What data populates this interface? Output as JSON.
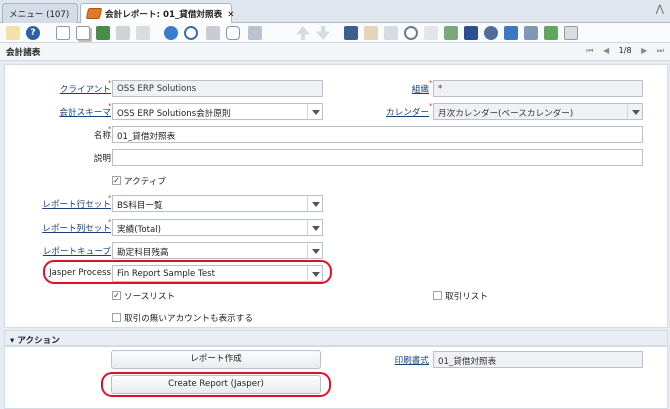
{
  "tabs": {
    "menu": {
      "label": "メニュー (107)"
    },
    "active": {
      "label": "会計レポート: 01_貸借対照表",
      "close": "✕"
    }
  },
  "toolbar": {
    "icons": [
      "undo-icon",
      "help-icon",
      "new-icon",
      "copy-icon",
      "delete-icon",
      "save-icon",
      "save-new-icon",
      "refresh-icon",
      "find-icon",
      "attachment-icon",
      "chat-icon",
      "history-icon",
      "up-icon",
      "down-icon",
      "report-icon",
      "archive-icon",
      "print-preview-icon",
      "zoom-icon",
      "print-icon",
      "workflow-icon",
      "request-icon",
      "product-info-icon",
      "settings-icon",
      "export-icon",
      "import-icon",
      "window-icon"
    ],
    "collapse": "⋀"
  },
  "header": {
    "title": "会計諸表",
    "nav_first": "⏮",
    "nav_prev": "◀",
    "record": "1/8",
    "nav_next": "▶",
    "nav_last": "⏭"
  },
  "form": {
    "client": {
      "label": "クライアント",
      "value": "OSS ERP Solutions"
    },
    "org": {
      "label": "組織",
      "value": "*"
    },
    "schema": {
      "label": "会計スキーマ",
      "value": "OSS ERP Solutions会計原則"
    },
    "calendar": {
      "label": "カレンダー",
      "value": "月次カレンダー(ベースカレンダー)"
    },
    "name": {
      "label": "名称",
      "value": "01_貸借対照表"
    },
    "description": {
      "label": "説明",
      "value": ""
    },
    "active": {
      "label": "アクティブ",
      "mark": "✓"
    },
    "line_set": {
      "label": "レポート行セット",
      "value": "BS科目一覧"
    },
    "column_set": {
      "label": "レポート列セット",
      "value": "実績(Total)"
    },
    "cube": {
      "label": "レポートキューブ",
      "value": "勘定科目残高"
    },
    "jasper": {
      "label": "Jasper Process",
      "value": "Fin Report Sample Test"
    },
    "source_list": {
      "label": "ソースリスト",
      "mark": "✓"
    },
    "txn_list": {
      "label": "取引リスト",
      "mark": ""
    },
    "show_no_txn": {
      "label": "取引の無いアカウントも表示する",
      "mark": ""
    }
  },
  "action": {
    "title": "アクション",
    "toggle": "▾",
    "create_report": "レポート作成",
    "create_report_jasper": "Create Report (Jasper)",
    "print_format": {
      "label": "印刷書式",
      "value": "01_貸借対照表"
    }
  },
  "colors": {
    "highlight": "#e0102a",
    "link": "#1b3f77",
    "tab_icon": "#e07a26"
  }
}
